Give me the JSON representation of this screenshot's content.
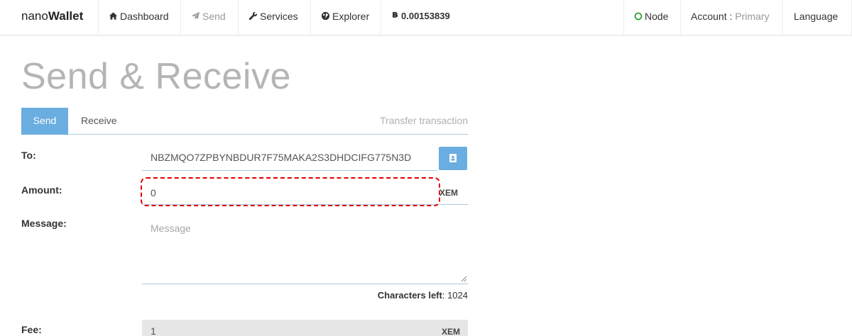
{
  "brand": {
    "light": "nano",
    "bold": "Wallet"
  },
  "nav": {
    "dashboard": "Dashboard",
    "send": "Send",
    "services": "Services",
    "explorer": "Explorer",
    "balance": "0.00153839",
    "node": "Node",
    "account_label": "Account :",
    "account_name": "Primary",
    "language": "Language"
  },
  "page": {
    "title": "Send & Receive"
  },
  "tabs": {
    "send": "Send",
    "receive": "Receive",
    "hint": "Transfer transaction"
  },
  "form": {
    "to_label": "To:",
    "to_value": "NBZMQO7ZPBYNBDUR7F75MAKA2S3DHDCIFG775N3D",
    "amount_label": "Amount:",
    "amount_value": "0",
    "amount_unit": "XEM",
    "message_label": "Message:",
    "message_placeholder": "Message",
    "chars_left_label": "Characters left",
    "chars_left_value": "1024",
    "fee_label": "Fee:",
    "fee_value": "1",
    "fee_unit": "XEM"
  },
  "icons": {
    "dashboard": "home-icon",
    "send": "paper-plane-icon",
    "services": "wrench-icon",
    "explorer": "globe-icon",
    "balance": "bitcoin-icon",
    "node": "circle-status-icon",
    "address_book": "address-book-icon"
  },
  "colors": {
    "accent": "#6aade0",
    "node_status": "#2ca02c",
    "highlight": "#e00000",
    "title": "#b5b5b5"
  }
}
